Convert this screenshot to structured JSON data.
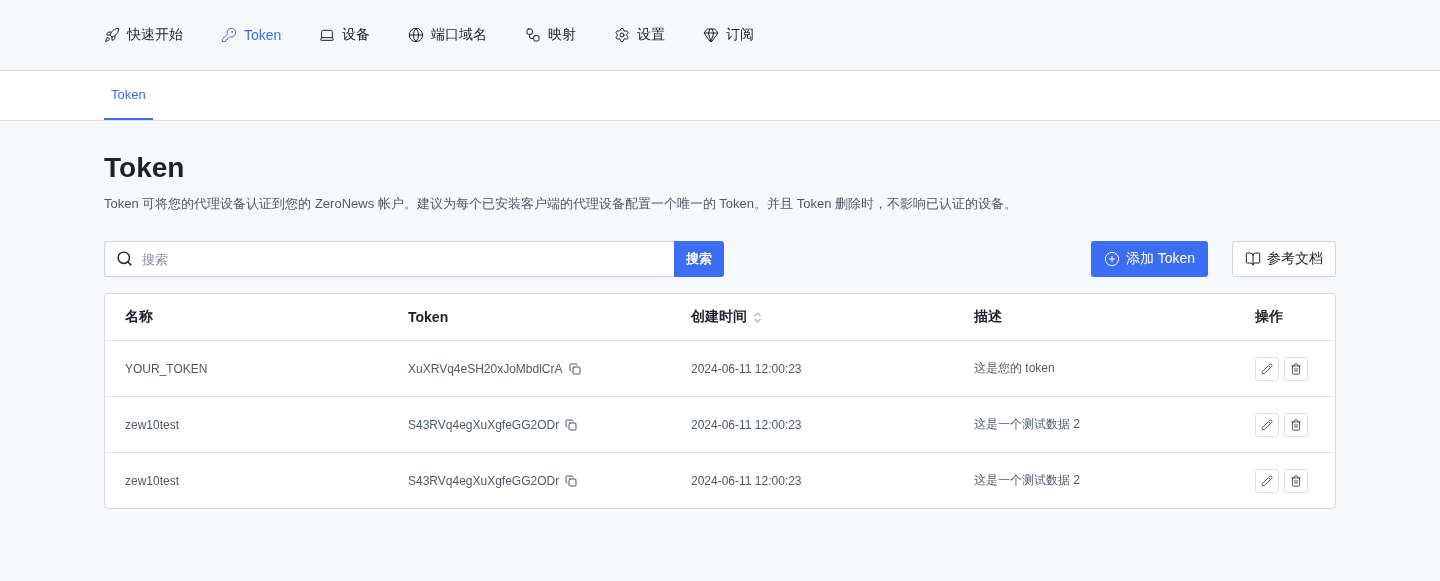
{
  "nav": [
    {
      "label": "快速开始",
      "selected": false
    },
    {
      "label": "Token",
      "selected": true
    },
    {
      "label": "设备",
      "selected": false
    },
    {
      "label": "端口域名",
      "selected": false
    },
    {
      "label": "映射",
      "selected": false
    },
    {
      "label": "设置",
      "selected": false
    },
    {
      "label": "订阅",
      "selected": false
    }
  ],
  "tabs": [
    {
      "label": "Token",
      "selected": true
    }
  ],
  "title": "Token",
  "description": "Token 可将您的代理设备认证到您的 ZeroNews 帐户。建议为每个已安装客户端的代理设备配置一个唯一的 Token。并且 Token 删除时，不影响已认证的设备。",
  "search": {
    "placeholder": "搜索",
    "button": "搜索"
  },
  "add_button": "添加 Token",
  "docs_button": "参考文档",
  "table": {
    "columns": [
      {
        "label": "名称",
        "sortable": false
      },
      {
        "label": "Token",
        "sortable": false
      },
      {
        "label": "创建时间",
        "sortable": true
      },
      {
        "label": "描述",
        "sortable": false
      },
      {
        "label": "操作",
        "sortable": false
      }
    ],
    "rows": [
      {
        "name": "YOUR_TOKEN",
        "token": "XuXRVq4eSH20xJoMbdlCrA",
        "created": "2024-06-11 12:00:23",
        "description": "这是您的 token"
      },
      {
        "name": "zew10test",
        "token": "S43RVq4egXuXgfeGG2ODr",
        "created": "2024-06-11 12:00:23",
        "description": "这是一个测试数据 2"
      },
      {
        "name": "zew10test",
        "token": "S43RVq4egXuXgfeGG2ODr",
        "created": "2024-06-11 12:00:23",
        "description": "这是一个测试数据 2"
      }
    ]
  }
}
